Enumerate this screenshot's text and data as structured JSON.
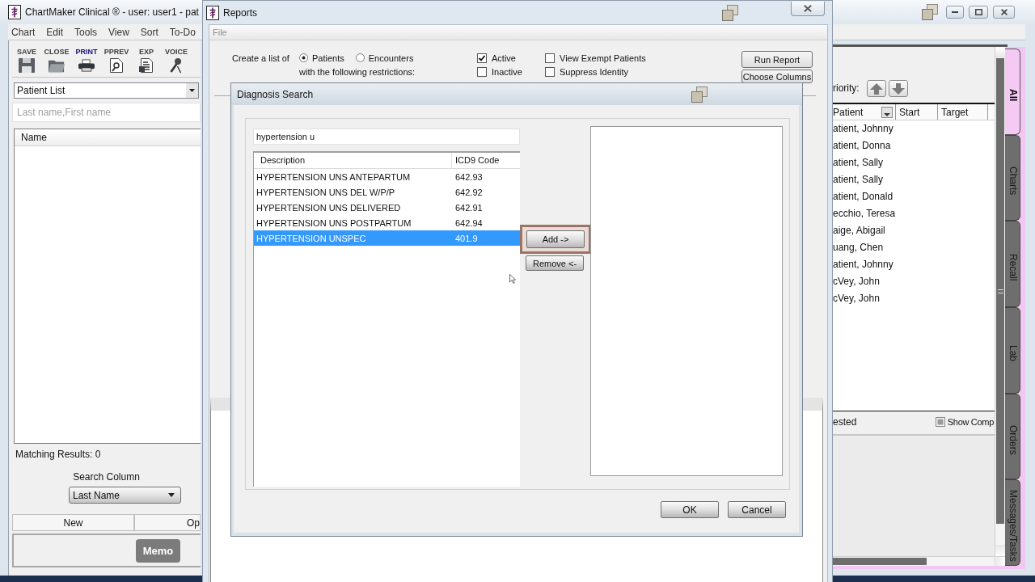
{
  "main_window": {
    "title": "ChartMaker Clinical ® - user: user1 - pat",
    "menu": [
      "Chart",
      "Edit",
      "Tools",
      "View",
      "Sort",
      "To-Do"
    ],
    "toolbar": [
      {
        "label": "SAVE",
        "kind": "save",
        "highlighted": false
      },
      {
        "label": "CLOSE",
        "kind": "close",
        "highlighted": false
      },
      {
        "label": "PRINT",
        "kind": "print",
        "highlighted": true
      },
      {
        "label": "PPREV",
        "kind": "preview",
        "highlighted": false
      },
      {
        "label": "EXP",
        "kind": "export",
        "highlighted": false
      },
      {
        "label": "VOICE",
        "kind": "voice",
        "highlighted": false
      }
    ],
    "left_panel": {
      "list_selector": "Patient List",
      "search": {
        "placeholder": "Last name,First name"
      },
      "columns": [
        "Name"
      ],
      "matching_results": "Matching Results: 0",
      "search_column": {
        "label": "Search Column",
        "value": "Last Name"
      },
      "buttons": [
        "New",
        "Op"
      ],
      "bottom_buttons": [
        "Memo"
      ]
    },
    "right_panel": {
      "priority_label": "riority:",
      "columns": [
        "Patient",
        "Start",
        "Target"
      ],
      "rows": [
        "atient, Johnny",
        "atient, Donna",
        "atient, Sally",
        "atient, Sally",
        "atient, Donald",
        "ecchio, Teresa",
        "aige, Abigail",
        "uang, Chen",
        "atient, Johnny",
        "cVey, John",
        "cVey, John"
      ],
      "status_text": "ested",
      "show_completed": {
        "label": "Show Comp",
        "checked": false
      },
      "tabs": [
        {
          "label": "All",
          "selected": true
        },
        {
          "label": "Charts",
          "selected": false
        },
        {
          "label": "Recall",
          "selected": false
        },
        {
          "label": "Lab",
          "selected": false
        },
        {
          "label": "Orders",
          "selected": false
        },
        {
          "label": "Messages/Tasks",
          "selected": false
        }
      ]
    }
  },
  "reports_window": {
    "title": "Reports",
    "menu": [
      {
        "label": "File",
        "disabled": true
      }
    ],
    "create_label": "Create a list of",
    "list_types": [
      {
        "label": "Patients",
        "selected": true
      },
      {
        "label": "Encounters",
        "selected": false
      }
    ],
    "restrictions_label": "with the following restrictions:",
    "filter_columns": [
      [
        {
          "label": "Active",
          "checked": true
        },
        {
          "label": "Inactive",
          "checked": false
        }
      ],
      [
        {
          "label": "View Exempt Patients",
          "checked": false
        },
        {
          "label": "Suppress Identity",
          "checked": false
        }
      ]
    ],
    "buttons": [
      "Run Report",
      "Choose Columns"
    ]
  },
  "diagnosis_dialog": {
    "title": "Diagnosis Search",
    "search": {
      "value": "hypertension u"
    },
    "columns": [
      "Description",
      "ICD9 Code"
    ],
    "rows": [
      {
        "description": "HYPERTENSION UNS ANTEPARTUM",
        "code": "642.93",
        "selected": false
      },
      {
        "description": "HYPERTENSION UNS DEL W/P/P",
        "code": "642.92",
        "selected": false
      },
      {
        "description": "HYPERTENSION UNS DELIVERED",
        "code": "642.91",
        "selected": false
      },
      {
        "description": "HYPERTENSION UNS POSTPARTUM",
        "code": "642.94",
        "selected": false
      },
      {
        "description": "HYPERTENSION UNSPEC",
        "code": "401.9",
        "selected": true
      }
    ],
    "add_button": {
      "label": "Add ->",
      "focused": true
    },
    "remove_button": {
      "label": "Remove <-"
    },
    "buttons": [
      "OK",
      "Cancel"
    ]
  }
}
